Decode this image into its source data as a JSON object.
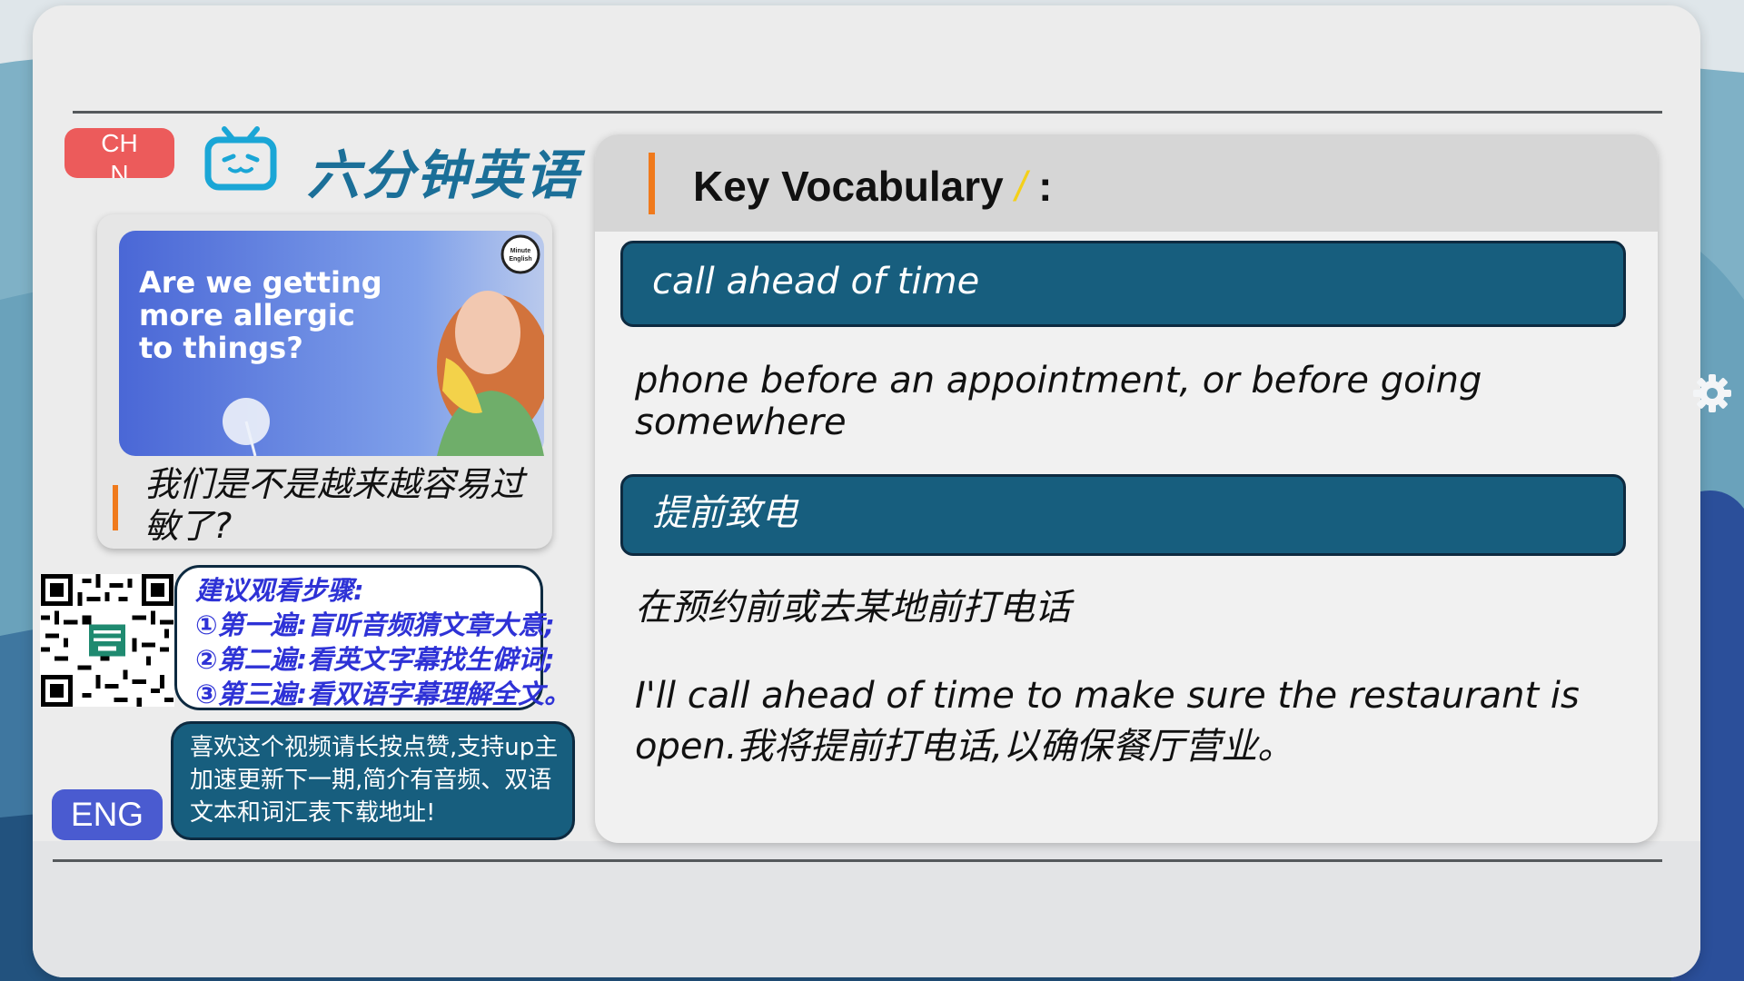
{
  "brand": {
    "title": "六分钟英语",
    "chn_button": "CHN",
    "eng_button": "ENG"
  },
  "thumbnail": {
    "headline_lines": [
      "Are we getting",
      "more allergic",
      "to things?"
    ],
    "badge_lines": [
      "Minute",
      "English"
    ],
    "caption": "我们是不是越来越容易过敏了?"
  },
  "steps": {
    "title": "建议观看步骤:",
    "items": [
      "①第一遍:盲听音频猜文章大意;",
      "②第二遍:看英文字幕找生僻词;",
      "③第三遍:看双语字幕理解全文。"
    ]
  },
  "like_message": "喜欢这个视频请长按点赞,支持up主加速更新下一期,简介有音频、双语文本和词汇表下载地址!",
  "vocabulary": {
    "title": "Key Vocabulary",
    "highlight_mark": "/",
    "colon": ":",
    "term_en": "call ahead of time",
    "definition_en": "phone before an appointment, or before going somewhere",
    "term_zh": "提前致电",
    "definition_zh": "在预约前或去某地前打电话",
    "example": "I'll call ahead of time to make sure the restaurant is open.我将提前打电话,以确保餐厅营业。"
  },
  "colors": {
    "accent_orange": "#f07a1c",
    "term_bar": "#175e7e",
    "chn_button": "#ec5b5b",
    "eng_button": "#4a5bd0",
    "brand_blue": "#1b6f98",
    "steps_text": "#2e32d6"
  },
  "icons": [
    "tv-icon",
    "gear-icon",
    "qr-code"
  ]
}
